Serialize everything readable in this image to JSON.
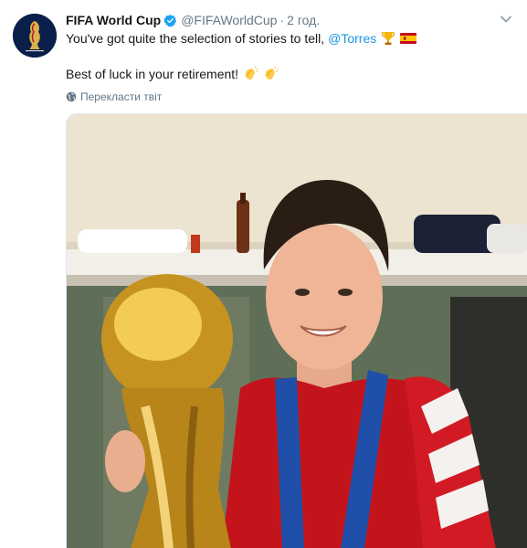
{
  "tweet": {
    "author_name": "FIFA World Cup",
    "handle": "@FIFAWorldCup",
    "separator": "·",
    "time": "2 год.",
    "text_line1": "You've got quite the selection of stories to tell,",
    "mention": "@Torres",
    "text_line2": "Best of luck in your retirement!",
    "translate_label": "Перекласти твіт",
    "emoji_line1": [
      "trophy-emoji",
      "spain-flag-emoji"
    ],
    "emoji_line2": [
      "clapping-hands-emoji",
      "clapping-hands-emoji"
    ]
  },
  "colors": {
    "link": "#1b95e0",
    "text": "#14171a",
    "muted": "#657786",
    "verified": "#1da1f2",
    "avatar_bg": "#0b1f4b"
  }
}
